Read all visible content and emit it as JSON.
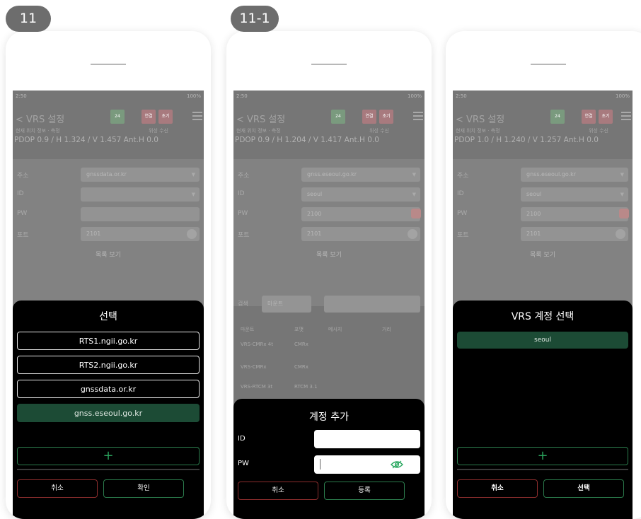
{
  "steps": [
    "11",
    "11-1"
  ],
  "common": {
    "status_time": "2:50",
    "status_right": "100%",
    "app_title": "< VRS 설정",
    "header_buttons": [
      "24",
      "연결",
      "초기"
    ],
    "info_line1_left": "현재 위치 정보 · 측정",
    "info_line1_right": "위성 수신",
    "labels": {
      "host": "주소",
      "id": "ID",
      "pw": "PW",
      "port": "포트"
    },
    "list_button": "목록 보기"
  },
  "panel1": {
    "info_line2": "PDOP 0.9 / H 1.324 / V 1.457   Ant.H 0.0",
    "host_value": "gnssdata.or.kr",
    "id_value": "",
    "pw_value": "",
    "port_value": "2101",
    "sheet": {
      "title": "선택",
      "options": [
        "RTS1.ngii.go.kr",
        "RTS2.ngii.go.kr",
        "gnssdata.or.kr",
        "gnss.eseoul.go.kr"
      ],
      "selected_index": 3,
      "add": "+",
      "cancel": "취소",
      "confirm": "확인"
    }
  },
  "panel2": {
    "info_line2": "PDOP 0.9 / H 1.204 / V 1.417   Ant.H 0.0",
    "host_value": "gnss.eseoul.go.kr",
    "id_value": "seoul",
    "pw_value": "2100",
    "port_value": "2101",
    "filter_label": "검색",
    "filter_value": "마운트",
    "table_header": [
      "마운트",
      "포맷",
      "메시지",
      "거리"
    ],
    "table_rows": [
      [
        "VRS-CMRx 4t",
        "CMRx"
      ],
      [
        "VRS-CMRx",
        "CMRx"
      ],
      [
        "VRS-RTCM 3t",
        "RTCM 3.1"
      ]
    ],
    "sheet": {
      "title": "계정 추가",
      "id_label": "ID",
      "pw_label": "PW",
      "id_value": "",
      "pw_value": "",
      "cancel": "취소",
      "register": "등록"
    }
  },
  "panel3": {
    "info_line2": "PDOP 1.0 / H 1.240 / V 1.257   Ant.H 0.0",
    "host_value": "gnss.eseoul.go.kr",
    "id_value": "seoul",
    "pw_value": "2100",
    "port_value": "2101",
    "sheet": {
      "title": "VRS 계정 선택",
      "accounts": [
        "seoul"
      ],
      "add": "+",
      "cancel": "취소",
      "select": "선택"
    }
  },
  "colors": {
    "accent_green": "#2b7b4c",
    "selected_fill": "#1c4b35",
    "cancel_red": "#8b2d2d",
    "sheet_bg": "#000000",
    "dim_overlay": "#767676"
  }
}
